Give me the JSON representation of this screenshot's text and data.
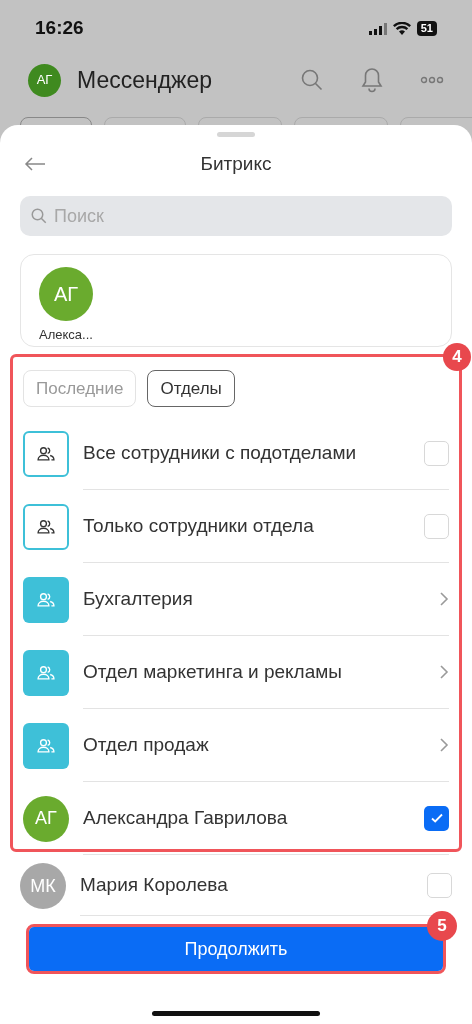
{
  "status_bar": {
    "time": "16:26",
    "battery": "51"
  },
  "header": {
    "avatar": "АГ",
    "title": "Мессенджер"
  },
  "sheet": {
    "title": "Битрикс",
    "search": {
      "placeholder": "Поиск"
    },
    "selected_people": [
      {
        "initials": "АГ",
        "name": "Алекса..."
      }
    ],
    "tabs": [
      {
        "label": "Последние",
        "selected": false
      },
      {
        "label": "Отделы",
        "selected": true
      }
    ],
    "items": [
      {
        "kind": "option",
        "label": "Все сотрудники с подотделами",
        "checked": false
      },
      {
        "kind": "option",
        "label": "Только сотрудники отдела",
        "checked": false
      },
      {
        "kind": "department",
        "label": "Бухгалтерия"
      },
      {
        "kind": "department",
        "label": "Отдел маркетинга и рекламы"
      },
      {
        "kind": "department",
        "label": "Отдел продаж"
      },
      {
        "kind": "person",
        "initials": "АГ",
        "label": "Александра Гаврилова",
        "checked": true,
        "color": "#6aab2e"
      }
    ],
    "more_items": [
      {
        "kind": "person",
        "initials": "МК",
        "label": "Мария Королева",
        "checked": false,
        "color": "#a8a8a8"
      }
    ],
    "continue_button": "Продолжить"
  },
  "annotations": [
    {
      "number": "4"
    },
    {
      "number": "5"
    }
  ]
}
